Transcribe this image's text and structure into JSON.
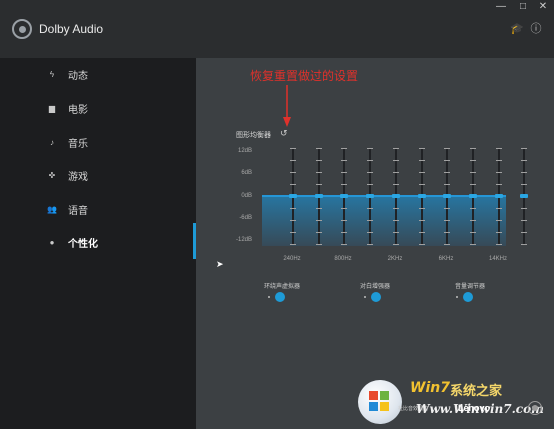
{
  "window": {
    "title": "Dolby Audio",
    "controls": {
      "minimize": "—",
      "maximize": "□",
      "close": "✕"
    },
    "header_icons": [
      {
        "name": "graduation-cap-icon",
        "glyph": "🎓"
      },
      {
        "name": "info-icon",
        "glyph": "ⓘ"
      }
    ]
  },
  "sidebar": {
    "items": [
      {
        "label": "动态",
        "icon": "lightning-icon",
        "glyph": "ϟ"
      },
      {
        "label": "电影",
        "icon": "film-icon",
        "glyph": "▆"
      },
      {
        "label": "音乐",
        "icon": "music-note-icon",
        "glyph": "♪"
      },
      {
        "label": "游戏",
        "icon": "gamepad-icon",
        "glyph": "✜"
      },
      {
        "label": "语音",
        "icon": "people-icon",
        "glyph": "👥"
      },
      {
        "label": "个性化",
        "icon": "person-icon",
        "glyph": "●"
      }
    ],
    "active_index": 5
  },
  "annotation": "恢复重置做过的设置",
  "equalizer": {
    "title": "图形均衡器",
    "db_labels": [
      "12dB",
      "6dB",
      "0dB",
      "-6dB",
      "-12dB"
    ],
    "freq_labels": [
      "240Hz",
      "800Hz",
      "2KHz",
      "6KHz",
      "14KHz"
    ],
    "band_count": 10,
    "band_values_db": [
      0,
      0,
      0,
      0,
      0,
      0,
      0,
      0,
      0,
      0
    ]
  },
  "toggles": [
    {
      "label": "环绕声虚拟器",
      "on": true
    },
    {
      "label": "对白增强器",
      "on": true
    },
    {
      "label": "音量调节器",
      "on": true
    }
  ],
  "watermark": {
    "brand": "Win7",
    "cn": "系统之家",
    "url": "Www.Winwin7.com",
    "small": "杜比音效调优"
  },
  "footer": {
    "oem": "Lenovo"
  },
  "colors": {
    "accent": "#1e9bd7",
    "annotation": "#e0312b",
    "sidebar_bg": "#1c1d1f",
    "main_bg": "#3c4043"
  }
}
